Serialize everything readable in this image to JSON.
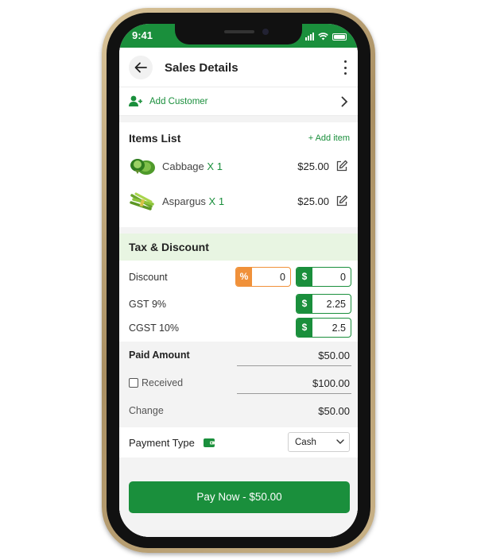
{
  "status_bar": {
    "time": "9:41"
  },
  "header": {
    "title": "Sales Details"
  },
  "customer": {
    "label": "Add Customer"
  },
  "items": {
    "title": "Items List",
    "add_label": "+ Add item",
    "list": [
      {
        "name": "Cabbage",
        "qty": "X 1",
        "price": "$25.00",
        "icon": "cabbage-icon"
      },
      {
        "name": "Aspargus",
        "qty": "X 1",
        "price": "$25.00",
        "icon": "asparagus-icon"
      }
    ]
  },
  "tax": {
    "title": "Tax & Discount",
    "discount": {
      "label": "Discount",
      "percent_symbol": "%",
      "percent_value": "0",
      "amount_symbol": "$",
      "amount_value": "0"
    },
    "gst": {
      "label": "GST 9%",
      "symbol": "$",
      "value": "2.25"
    },
    "cgst": {
      "label": "CGST 10%",
      "symbol": "$",
      "value": "2.5"
    }
  },
  "payment": {
    "paid_label": "Paid Amount",
    "paid_value": "$50.00",
    "received_label": "Received",
    "received_value": "$100.00",
    "received_checked": false,
    "change_label": "Change",
    "change_value": "$50.00",
    "type_label": "Payment Type",
    "type_value": "Cash"
  },
  "footer": {
    "pay_button": "Pay Now - $50.00"
  },
  "colors": {
    "primary": "#1a8f3c",
    "accent_orange": "#f0913a",
    "section_tint": "#e8f5e2"
  }
}
